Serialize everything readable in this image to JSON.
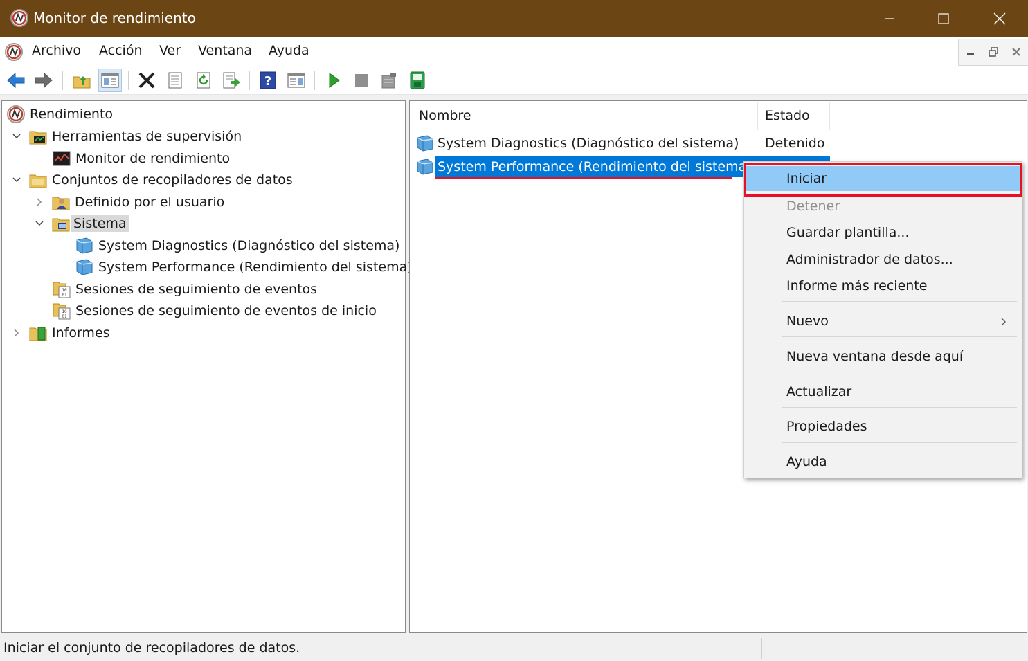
{
  "window": {
    "title": "Monitor de rendimiento"
  },
  "menubar": {
    "items": [
      "Archivo",
      "Acción",
      "Ver",
      "Ventana",
      "Ayuda"
    ]
  },
  "toolbar": {
    "icons": [
      "back-arrow-icon",
      "forward-arrow-icon",
      "up-folder-icon",
      "show-hide-tree-icon",
      "delete-icon",
      "properties-icon",
      "refresh-icon",
      "export-list-icon",
      "help-icon",
      "show-hide-action-pane-icon",
      "start-icon",
      "stop-icon",
      "new-data-collector-icon",
      "save-icon"
    ]
  },
  "tree": {
    "root": "Rendimiento",
    "items": [
      {
        "label": "Herramientas de supervisión",
        "expanded": true
      },
      {
        "label": "Monitor de rendimiento"
      },
      {
        "label": "Conjuntos de recopiladores de datos",
        "expanded": true
      },
      {
        "label": "Definido por el usuario",
        "expanded": false
      },
      {
        "label": "Sistema",
        "expanded": true,
        "selected": true
      },
      {
        "label": "System Diagnostics (Diagnóstico del sistema)"
      },
      {
        "label": "System Performance (Rendimiento del sistema)"
      },
      {
        "label": "Sesiones de seguimiento de eventos"
      },
      {
        "label": "Sesiones de seguimiento de eventos de inicio"
      },
      {
        "label": "Informes",
        "expanded": false
      }
    ]
  },
  "list": {
    "columns": [
      "Nombre",
      "Estado"
    ],
    "rows": [
      {
        "name": "System Diagnostics (Diagnóstico del sistema)",
        "status": "Detenido"
      },
      {
        "name": "System Performance (Rendimiento del sistema)",
        "status": "",
        "selected": true
      }
    ]
  },
  "context_menu": {
    "items": [
      {
        "label": "Iniciar",
        "highlighted": true
      },
      {
        "label": "Detener",
        "disabled": true
      },
      {
        "label": "Guardar plantilla..."
      },
      {
        "label": "Administrador de datos..."
      },
      {
        "label": "Informe más reciente"
      },
      {
        "label": "Nuevo",
        "submenu": true
      },
      {
        "label": "Nueva ventana desde aquí"
      },
      {
        "label": "Actualizar"
      },
      {
        "label": "Propiedades"
      },
      {
        "label": "Ayuda"
      }
    ]
  },
  "statusbar": {
    "text": "Iniciar el conjunto de recopiladores de datos."
  },
  "colors": {
    "titlebar": "#6b4514",
    "selection": "#0078d7",
    "menu_highlight": "#91c9f7",
    "annotation_red": "#e81123"
  }
}
